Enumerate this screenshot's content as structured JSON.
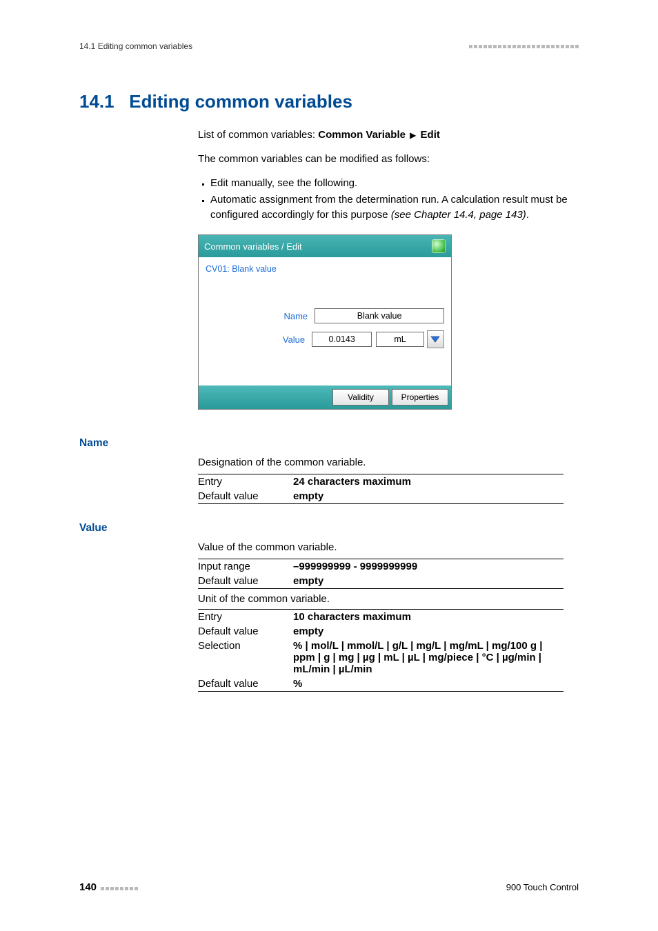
{
  "header": {
    "left": "14.1 Editing common variables"
  },
  "section": {
    "number": "14.1",
    "title": "Editing common variables"
  },
  "intro": {
    "breadcrumb_prefix": "List of common variables: ",
    "breadcrumb_strong1": "Common Variable",
    "breadcrumb_strong2": "Edit",
    "line2": "The common variables can be modified as follows:",
    "bullets": [
      "Edit manually, see the following.",
      "Automatic assignment from the determination run. A calculation result must be configured accordingly for this purpose "
    ],
    "bullet2_italic": "(see Chapter 14.4, page 143)",
    "bullet2_tail": "."
  },
  "panel": {
    "title": "Common variables / Edit",
    "sub": "CV01: Blank value",
    "name_label": "Name",
    "name_value": "Blank value",
    "value_label": "Value",
    "value_value": "0.0143",
    "unit_value": "mL",
    "btn_validity": "Validity",
    "btn_properties": "Properties"
  },
  "defs": {
    "name": {
      "heading": "Name",
      "desc": "Designation of the common variable.",
      "rows": [
        {
          "k": "Entry",
          "v": "24 characters maximum"
        },
        {
          "k": "Default value",
          "v": "empty"
        }
      ]
    },
    "value": {
      "heading": "Value",
      "desc": "Value of the common variable.",
      "rows1": [
        {
          "k": "Input range",
          "v": "–999999999 - 9999999999"
        },
        {
          "k": "Default value",
          "v": "empty"
        }
      ],
      "mid": "Unit of the common variable.",
      "rows2": [
        {
          "k": "Entry",
          "v": "10 characters maximum"
        },
        {
          "k": "Default value",
          "v": "empty"
        },
        {
          "k": "Selection",
          "v": "% | mol/L | mmol/L | g/L | mg/L | mg/mL | mg/100 g | ppm | g | mg | µg | mL | µL | mg/piece | °C | µg/min | mL/min | µL/min"
        },
        {
          "k": "Default value",
          "v": "%"
        }
      ]
    }
  },
  "footer": {
    "page": "140",
    "product": "900 Touch Control"
  }
}
